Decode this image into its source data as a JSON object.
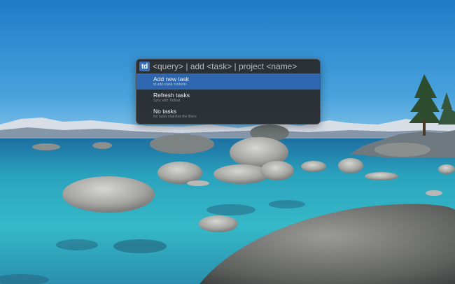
{
  "launcher": {
    "app_icon_label": "td",
    "query_placeholder": "<query> | add <task> | project <name>",
    "results": [
      {
        "title": "Add new task",
        "subtitle": "td add <task content>",
        "selected": true
      },
      {
        "title": "Refresh tasks",
        "subtitle": "Sync with Todoist",
        "selected": false
      },
      {
        "title": "No tasks",
        "subtitle": "No tasks matched the filters",
        "selected": false
      }
    ]
  },
  "colors": {
    "selection": "#2e66b0",
    "launcher_bg": "#28282a",
    "sky": "#2f8fd0",
    "water": "#2bb3c6"
  },
  "wallpaper": {
    "description_icon": "lake-wallpaper"
  }
}
